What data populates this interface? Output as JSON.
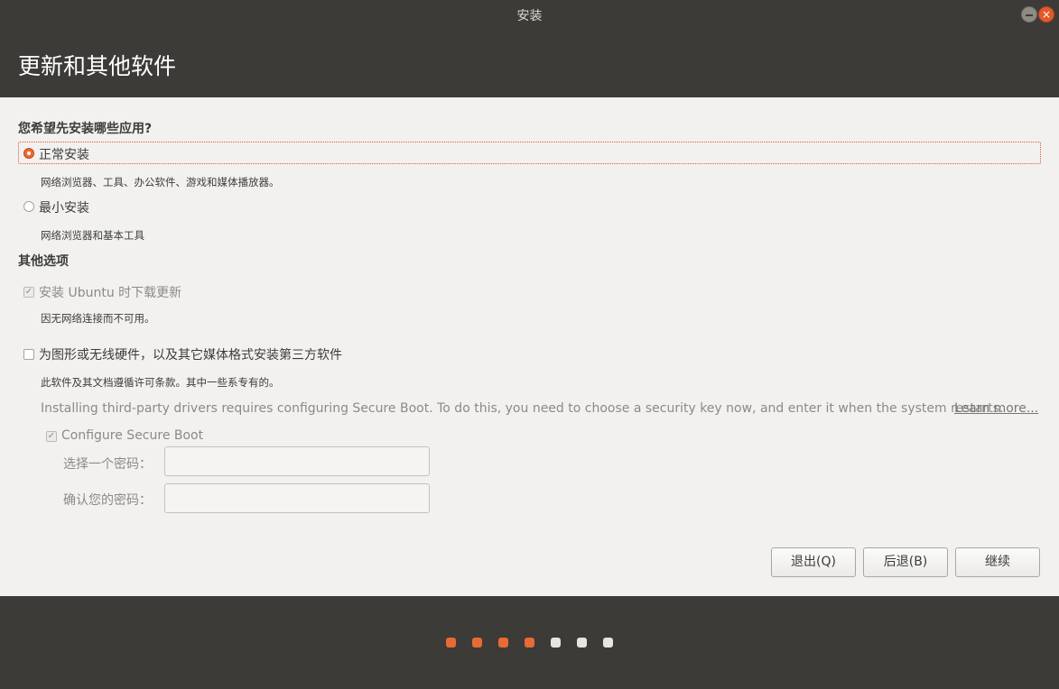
{
  "window": {
    "title": "安装",
    "close_glyph": "×"
  },
  "page": {
    "title": "更新和其他软件"
  },
  "install_type": {
    "question": "您希望先安装哪些应用?",
    "options": [
      {
        "label": "正常安装",
        "description": "网络浏览器、工具、办公软件、游戏和媒体播放器。",
        "selected": true
      },
      {
        "label": "最小安装",
        "description": "网络浏览器和基本工具",
        "selected": false
      }
    ]
  },
  "other_options": {
    "heading": "其他选项",
    "download_updates": {
      "label": "安装 Ubuntu 时下载更新",
      "note": "因无网络连接而不可用。",
      "checked": true,
      "disabled": true
    },
    "third_party": {
      "label": "为图形或无线硬件，以及其它媒体格式安装第三方软件",
      "note": "此软件及其文档遵循许可条款。其中一些系专有的。",
      "secure_boot_info": "Installing third-party drivers requires configuring Secure Boot. To do this, you need to choose a security key now, and enter it when the system restarts.",
      "learn_more": "Learn more...",
      "checked": false
    },
    "secure_boot": {
      "label": "Configure Secure Boot",
      "checked": true,
      "password_label": "选择一个密码：",
      "password_value": "",
      "confirm_label": "确认您的密码：",
      "confirm_value": ""
    }
  },
  "buttons": {
    "quit": "退出(Q)",
    "back": "后退(B)",
    "continue": "继续"
  },
  "progress": {
    "total_steps": 7,
    "completed_steps": 4
  },
  "colors": {
    "accent": "#e86a35",
    "dark_bg": "#3c3b37",
    "content_bg": "#f2f1f0"
  }
}
